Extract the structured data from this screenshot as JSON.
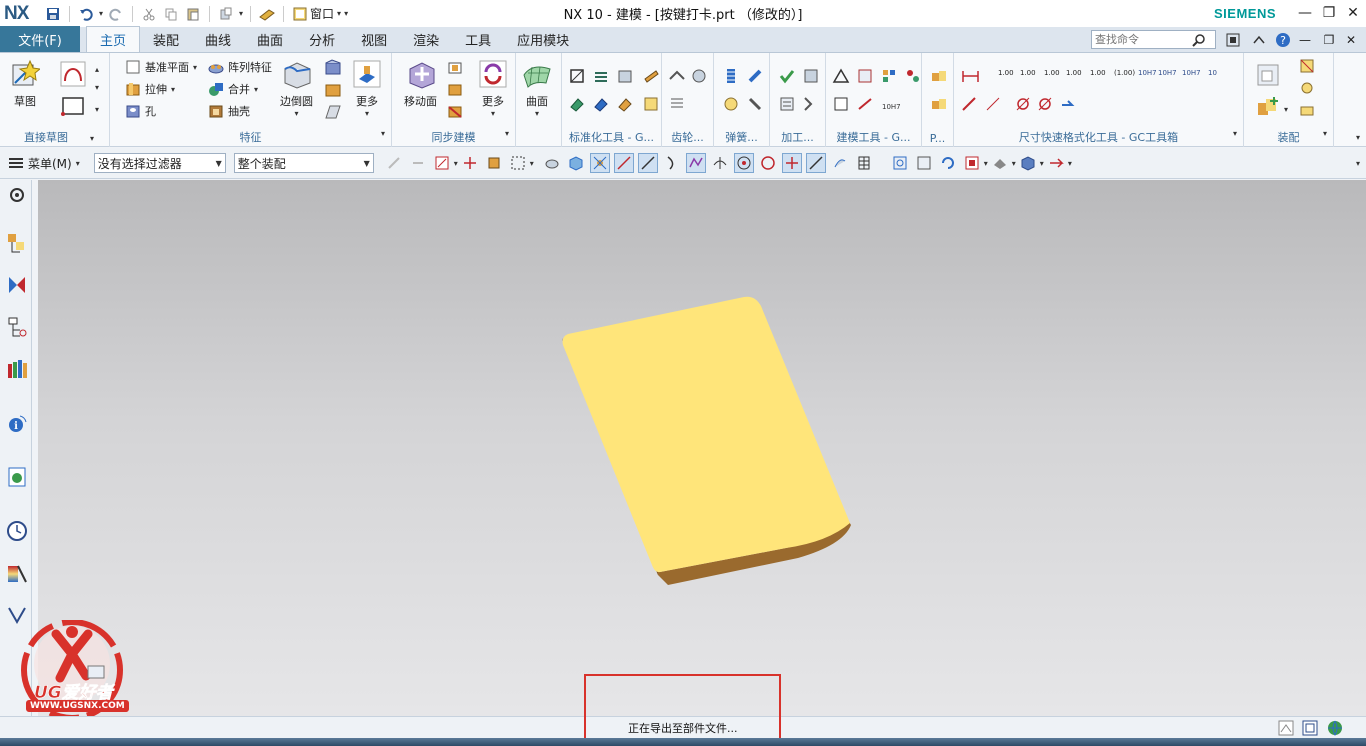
{
  "app": {
    "logo": "NX",
    "window_title": "NX 10 - 建模 - [按键打卡.prt （修改的）]",
    "brand": "SIEMENS",
    "window_menu_label": "窗口"
  },
  "tabs": {
    "file": "文件(F)",
    "items": [
      "主页",
      "装配",
      "曲线",
      "曲面",
      "分析",
      "视图",
      "渲染",
      "工具",
      "应用模块"
    ],
    "active": "主页"
  },
  "search": {
    "placeholder": "查找命令"
  },
  "ribbon": {
    "sketch": {
      "button": "草图",
      "label": "直接草图"
    },
    "feature": {
      "label": "特征",
      "datum_plane": "基准平面",
      "extrude": "拉伸",
      "hole": "孔",
      "pattern": "阵列特征",
      "unite": "合并",
      "shell": "抽壳",
      "edge_blend": "边倒圆",
      "more": "更多"
    },
    "sync": {
      "move_face": "移动面",
      "more": "更多",
      "label": "同步建模"
    },
    "surface": {
      "button": "曲面"
    },
    "group_labels": {
      "std_tools": "标准化工具 - G...",
      "gear": "齿轮...",
      "spring": "弹簧...",
      "machining": "加工...",
      "modeling_tools": "建模工具 - G...",
      "p": "P...",
      "dimension": "尺寸快速格式化工具 - GC工具箱",
      "assembly": "装配"
    },
    "dim_values": [
      "1.00",
      "1.00",
      "1.00",
      "1.00",
      "1.00",
      "(1.00)",
      "10H7",
      "10H7",
      "10H7",
      "10"
    ]
  },
  "selection_bar": {
    "menu": "菜单(M)",
    "filter": "没有选择过滤器",
    "scope": "整个装配"
  },
  "status": {
    "message": "正在导出至部件文件..."
  },
  "watermark": {
    "brand": "UG爱好者",
    "url": "WWW.UGSNX.COM"
  },
  "colors": {
    "file_tab": "#37779a",
    "accent": "#1b6bb0",
    "siemens": "#009999",
    "part_top": "#ffe57a",
    "part_side": "#9a6a2e",
    "highlight": "#d8322b"
  }
}
